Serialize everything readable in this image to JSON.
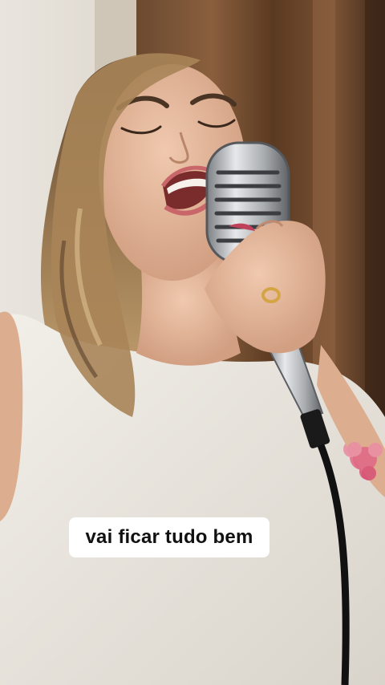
{
  "video": {
    "caption": "vai ficar tudo bem",
    "subject": "singer-with-vintage-microphone"
  },
  "colors": {
    "wall": "#d9d2c6",
    "wood_curtain": "#5a3a22",
    "hair": "#8a6a45",
    "skin": "#e3b79a",
    "top": "#ebe7df",
    "microphone": "#b9bbbd",
    "caption_bg": "#ffffff",
    "caption_text": "#111111",
    "tattoo": "#e06a86"
  }
}
